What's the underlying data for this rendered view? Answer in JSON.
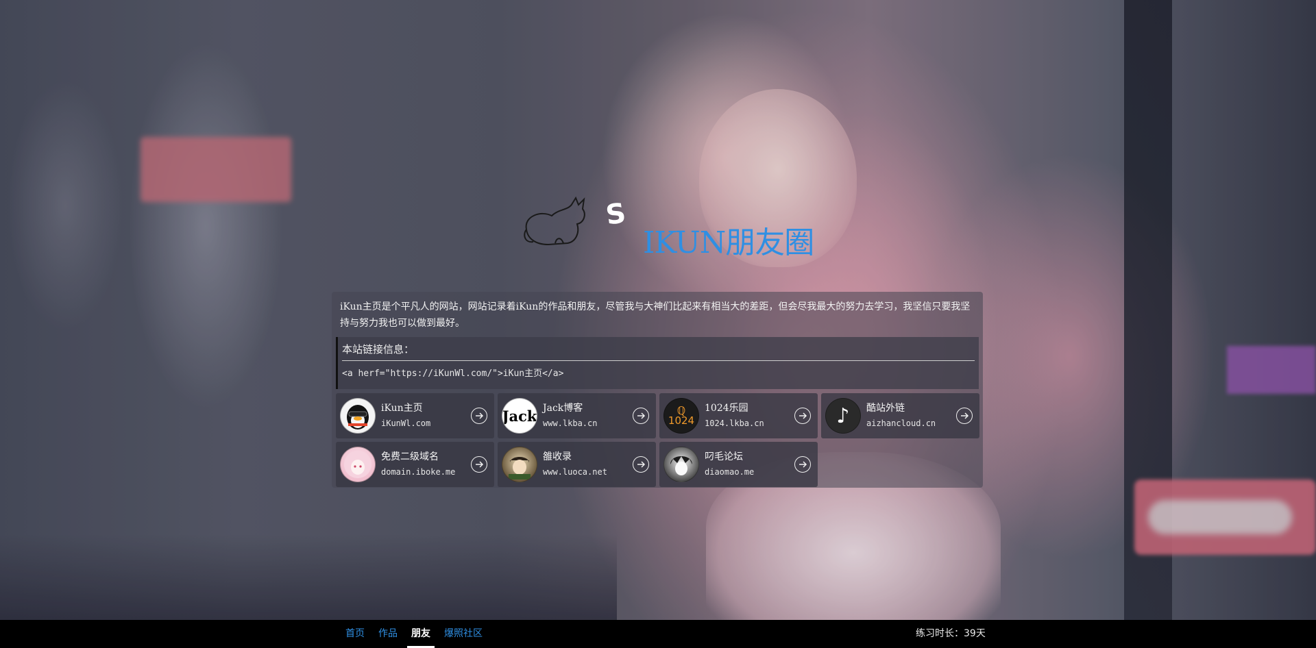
{
  "site": {
    "logo_letter": "S",
    "title": "IKUN朋友圈"
  },
  "intro": "iKun主页是个平凡人的网站，网站记录着iKun的作品和朋友，尽管我与大神们比起来有相当大的差距，但会尽我最大的努力去学习，我坚信只要我坚持与努力我也可以做到最好。",
  "link_info": {
    "title": "本站链接信息：",
    "code": "<a herf=\"https://iKunWl.com/\">iKun主页</a>"
  },
  "friends": [
    {
      "name": "iKun主页",
      "url": "iKunWl.com",
      "avatar": "penguin-avatar"
    },
    {
      "name": "Jack博客",
      "url": "www.lkba.cn",
      "avatar": "jack-avatar",
      "avatar_text": "Jack"
    },
    {
      "name": "1024乐园",
      "url": "1024.lkba.cn",
      "avatar": "1024-avatar",
      "avatar_text": "1024"
    },
    {
      "name": "酷站外链",
      "url": "aizhancloud.cn",
      "avatar": "tiktok-avatar",
      "avatar_text": "♪"
    },
    {
      "name": "免费二级域名",
      "url": "domain.iboke.me",
      "avatar": "anime-girl-avatar"
    },
    {
      "name": "雒收录",
      "url": "www.luoca.net",
      "avatar": "anime-boy-avatar"
    },
    {
      "name": "叼毛论坛",
      "url": "diaomao.me",
      "avatar": "anime-bw-avatar"
    }
  ],
  "nav": {
    "items": [
      {
        "label": "首页",
        "active": false
      },
      {
        "label": "作品",
        "active": false
      },
      {
        "label": "朋友",
        "active": true
      },
      {
        "label": "爆照社区",
        "active": false
      }
    ]
  },
  "practice_time": "练习时长：39天",
  "colors": {
    "accent": "#2f8fe3",
    "bottom_bar": "#000000"
  }
}
